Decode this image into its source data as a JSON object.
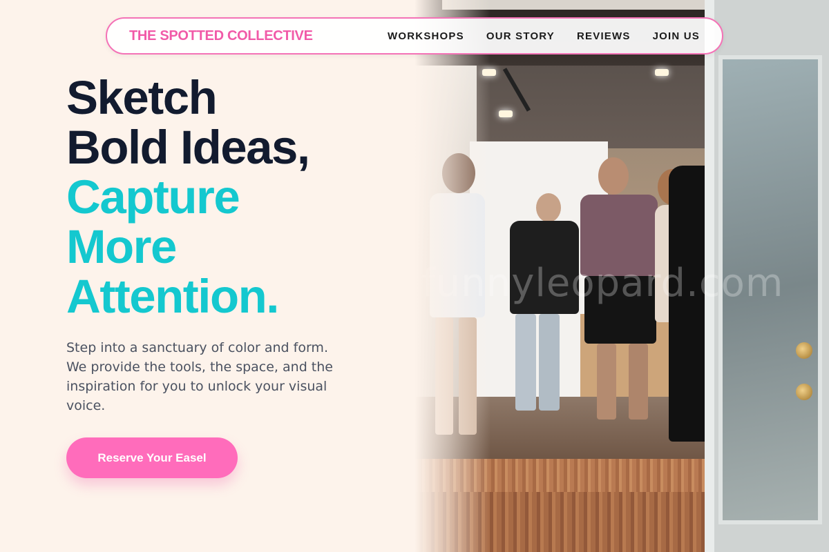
{
  "nav": {
    "brand": "THE SPOTTED COLLECTIVE",
    "links": [
      "WORKSHOPS",
      "OUR STORY",
      "REVIEWS",
      "JOIN US"
    ]
  },
  "hero": {
    "headline_lines_dark": [
      "Sketch",
      "Bold Ideas,"
    ],
    "headline_lines_accent": [
      "Capture",
      "More",
      "Attention."
    ],
    "intro": "Step into a sanctuary of color and form. We provide the tools, the space, and the inspiration for you to unlock your visual voice.",
    "cta_label": "Reserve Your Easel",
    "photo_watermark": "funnyleopard.com"
  },
  "colors": {
    "background": "#fdf3eb",
    "brand_pink": "#f15aa8",
    "accent_teal": "#14c8cf",
    "headline_dark": "#121b2f",
    "cta_pink": "#ff6cbb"
  }
}
